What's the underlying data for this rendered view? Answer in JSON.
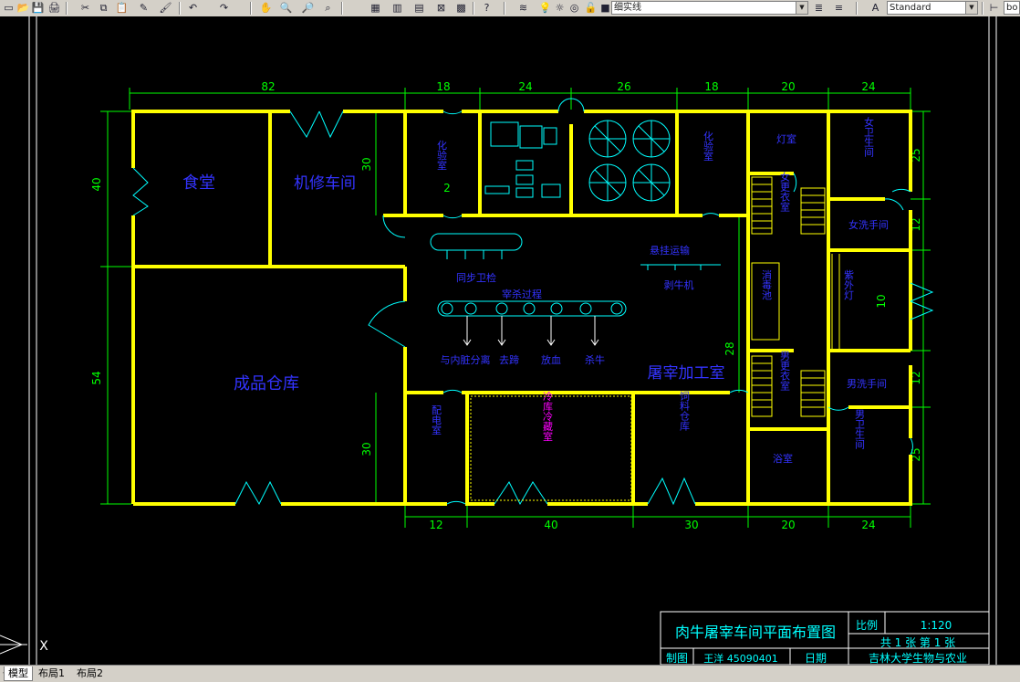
{
  "toolbar": {
    "linetype_label": "细实线",
    "textstyle_label": "Standard",
    "partial_label": "bo"
  },
  "tabs": [
    {
      "label": "模型",
      "active": true
    },
    {
      "label": "布局1",
      "active": false
    },
    {
      "label": "布局2",
      "active": false
    }
  ],
  "drawing": {
    "dims_top": [
      "82",
      "18",
      "24",
      "26",
      "18",
      "20",
      "24"
    ],
    "dims_bottom": [
      "12",
      "40",
      "30",
      "20",
      "24"
    ],
    "dims_left": [
      "40",
      "54"
    ],
    "dims_right": [
      "25",
      "12",
      "10",
      "12",
      "25"
    ],
    "dims_inner": [
      "30",
      "30",
      "28",
      "2"
    ],
    "rooms": {
      "canteen": "食堂",
      "repair": "机修车间",
      "warehouse": "成品仓库",
      "slaughter_room": "屠宰加工室",
      "chemlab_left": "化验室",
      "chemlab_right": "化验室",
      "lamp_room": "灯室",
      "sink_room": "洗手间",
      "female_wc": "女卫生间",
      "female_wash": "女洗手间",
      "female_change": "女更衣室",
      "pass_area": "消毒池",
      "uv_lamp": "紫外灯",
      "male_change": "男更衣室",
      "male_wash": "男洗手间",
      "male_wc": "男卫生间",
      "bath": "浴室",
      "dispatch_room": "配电室",
      "feed_store": "饲料仓库",
      "cold_store": "冷库冷藏室"
    },
    "process": {
      "sync_inspect": "同步卫检",
      "conveyor_label": "宰杀过程",
      "track_label": "悬挂运输",
      "machine_label": "剥牛机",
      "step1": "与内脏分离",
      "step2": "去蹄",
      "step3": "放血",
      "step4": "杀牛"
    },
    "coord_marker": "X"
  },
  "title_block": {
    "title": "肉牛屠宰车间平面布置图",
    "scale_label": "比例",
    "scale_value": "1:120",
    "sheets": "共 1 张  第 1 张",
    "drawn_label": "制图",
    "drawn_by": "王洋 45090401",
    "date_label": "日期",
    "org": "吉林大学生物与农业"
  },
  "colors": {
    "wall": "#ffff00",
    "dimension": "#00ff00",
    "room_text": "#3333ff",
    "equipment": "#00ffff",
    "frame": "#ffffff",
    "cold_store_text": "#ff00ff"
  }
}
